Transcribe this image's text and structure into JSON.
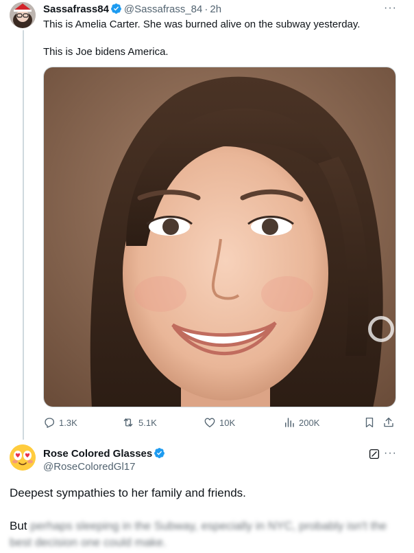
{
  "tweet": {
    "author_name": "Sassafrass84",
    "author_handle": "@Sassafrass_84",
    "separator": "·",
    "time": "2h",
    "more": "···",
    "text_line1": "This is Amelia Carter. She was burned alive on the subway yesterday.",
    "text_line2": "This is Joe bidens America.",
    "actions": {
      "replies": "1.3K",
      "reposts": "5.1K",
      "likes": "10K",
      "views": "200K"
    }
  },
  "reply": {
    "author_name": "Rose Colored Glasses",
    "author_handle": "@RoseColoredGl17",
    "more": "···",
    "text_line1": "Deepest sympathies to her family and friends.",
    "text_visible": "But",
    "text_blurred": "perhaps sleeping in the Subway, especially in NYC, probably isn't the best decision one could make."
  },
  "colors": {
    "verified": "#1d9bf0",
    "secondary_text": "#536471",
    "thread_line": "#cfd9de"
  }
}
